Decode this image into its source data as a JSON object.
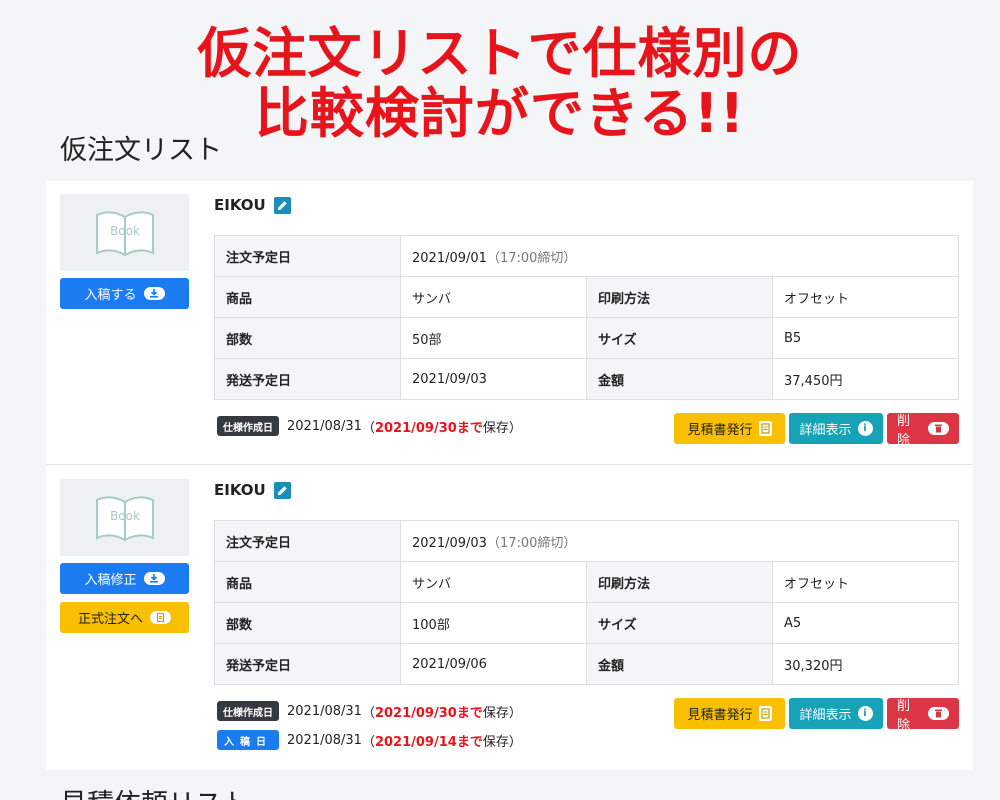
{
  "promo": {
    "line1": "仮注文リストで仕様別の",
    "line2": "比較検討ができる!!"
  },
  "section_title": "仮注文リスト",
  "next_section_title": "見積依頼リスト",
  "labels": {
    "order_date": "注文予定日",
    "product": "商品",
    "print_method": "印刷方法",
    "copies": "部数",
    "size": "サイズ",
    "ship_date": "発送予定日",
    "amount": "金額",
    "thumb_text": "Book",
    "btn_estimate": "見積書発行",
    "btn_detail": "詳細表示",
    "btn_delete": "削除"
  },
  "items": [
    {
      "name": "EIKOU",
      "order_date": "2021/09/01",
      "order_note": "（17:00締切）",
      "product": "サンバ",
      "print_method": "オフセット",
      "copies": "50部",
      "size": "B5",
      "ship_date": "2021/09/03",
      "amount": "37,450円",
      "upload_button": "入稿する",
      "spec_tag": "仕様作成日",
      "spec_date": "2021/08/31",
      "spec_open": "（",
      "spec_until": "2021/09/30まで",
      "spec_close": "保存）"
    },
    {
      "name": "EIKOU",
      "order_date": "2021/09/03",
      "order_note": "（17:00締切）",
      "product": "サンバ",
      "print_method": "オフセット",
      "copies": "100部",
      "size": "A5",
      "ship_date": "2021/09/06",
      "amount": "30,320円",
      "upload_button": "入稿修正",
      "formal_button": "正式注文へ",
      "spec_tag": "仕様作成日",
      "spec_date": "2021/08/31",
      "spec_open": "（",
      "spec_until": "2021/09/30まで",
      "spec_close": "保存）",
      "upload_tag": "入稿日",
      "upload_date": "2021/08/31",
      "upload_open": "（",
      "upload_until": "2021/09/14まで",
      "upload_close": "保存）"
    }
  ]
}
